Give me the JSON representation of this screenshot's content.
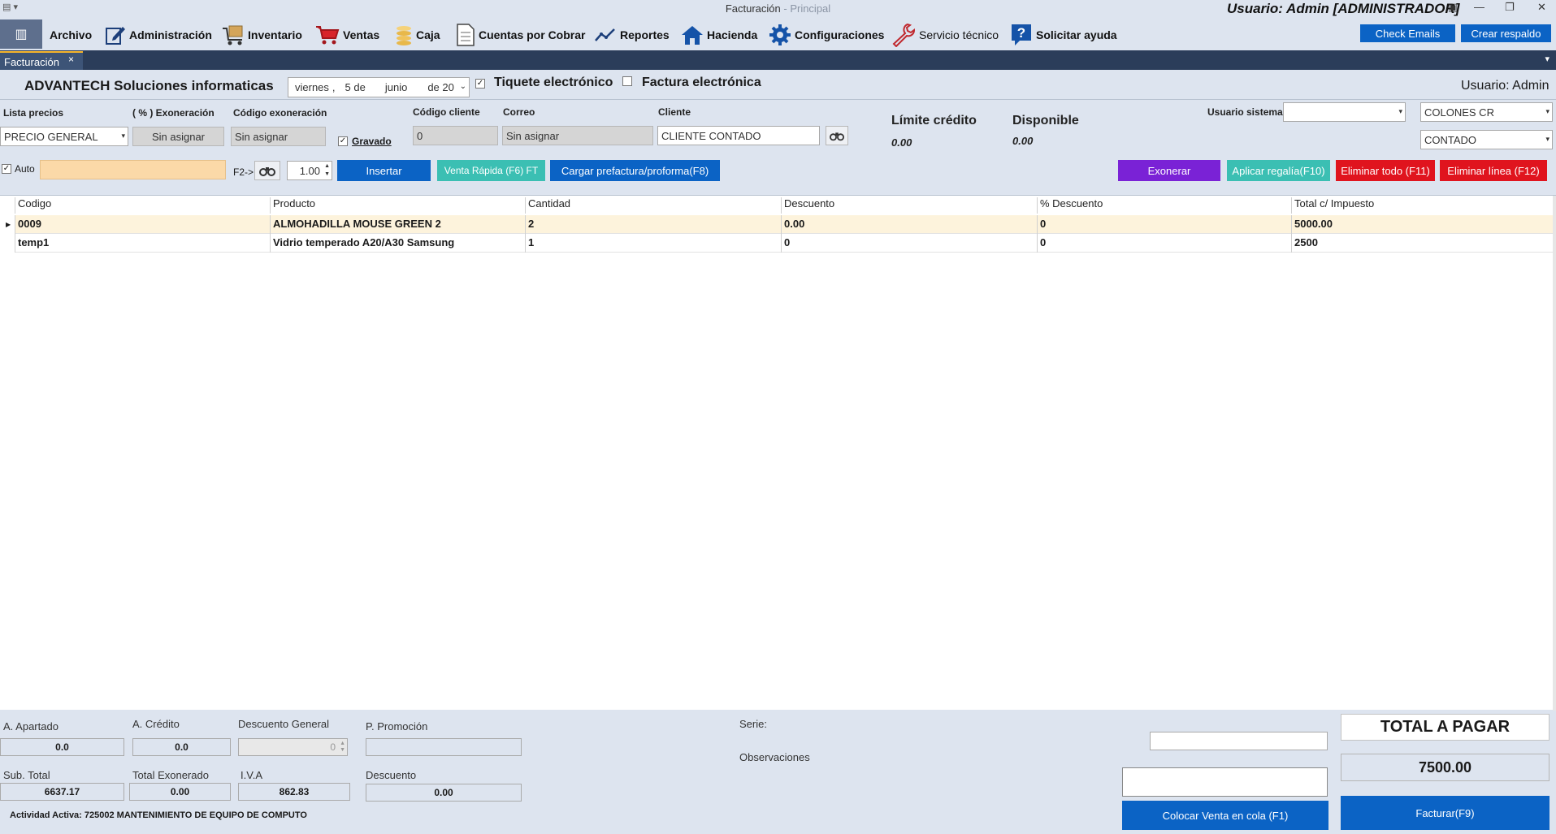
{
  "window": {
    "title": "Facturación",
    "subtitle": "- Principal",
    "user_label": "Usuario: Admin [ADMINISTRADOR]"
  },
  "menu": [
    {
      "label": "Archivo",
      "icon": "none"
    },
    {
      "label": "Administración",
      "icon": "edit-icon"
    },
    {
      "label": "Inventario",
      "icon": "cart-box-icon"
    },
    {
      "label": "Ventas",
      "icon": "shopping-cart-icon"
    },
    {
      "label": "Caja",
      "icon": "coins-icon"
    },
    {
      "label": "Cuentas por Cobrar",
      "icon": "document-icon"
    },
    {
      "label": "Reportes",
      "icon": "line-chart-icon"
    },
    {
      "label": "Hacienda",
      "icon": "home-icon"
    },
    {
      "label": "Configuraciones",
      "icon": "gear-icon"
    },
    {
      "label": "Servicio técnico",
      "icon": "wrench-icon"
    },
    {
      "label": "Solicitar ayuda",
      "icon": "help-icon"
    }
  ],
  "top_buttons": {
    "check_emails": "Check Emails",
    "backup": "Crear respaldo"
  },
  "tab": {
    "label": "Facturación",
    "close": "×"
  },
  "header": {
    "company": "ADVANTECH Soluciones informaticas",
    "date": {
      "weekday": "viernes",
      "sep": ",",
      "day": "5 de",
      "month": "junio",
      "year": "de 20"
    },
    "tiquete_label": "Tiquete electrónico",
    "tiquete_checked": true,
    "factura_label": "Factura electrónica",
    "factura_checked": false,
    "user": "Usuario: Admin"
  },
  "form": {
    "price_list_label": "Lista precios",
    "price_list_value": "PRECIO GENERAL",
    "exoneration_pct_label": "( % ) Exoneración",
    "exoneration_pct_value": "Sin asignar",
    "exoneration_code_label": "Código exoneración",
    "exoneration_code_value": "Sin asignar",
    "gravado_label": "Gravado",
    "gravado_checked": true,
    "client_code_label": "Código cliente",
    "client_code_value": "0",
    "email_label": "Correo",
    "email_value": "Sin asignar",
    "client_label": "Cliente",
    "client_value": "CLIENTE CONTADO",
    "credit_limit_label": "Límite crédito",
    "credit_limit_value": "0.00",
    "available_label": "Disponible",
    "available_value": "0.00",
    "system_user_label": "Usuario sistema",
    "system_user_value": "",
    "currency_value": "COLONES CR",
    "payment_value": "CONTADO",
    "auto_label": "Auto",
    "auto_checked": true,
    "product_search_value": "",
    "f2_label": "F2->",
    "quantity_value": "1.00"
  },
  "actions": {
    "insert": "Insertar",
    "quick_sale": "Venta Rápida (F6) FT",
    "load_proforma": "Cargar prefactura/proforma(F8)",
    "exonerate": "Exonerar",
    "gift": "Aplicar regalía(F10)",
    "delete_all": "Eliminar todo (F11)",
    "delete_line": "Eliminar línea (F12)"
  },
  "colors": {
    "blue": "#0b63c5",
    "teal": "#3bbfb3",
    "purple": "#7a22d6",
    "red": "#e0141e",
    "selected_row": "#fdf3dc"
  },
  "table": {
    "columns": [
      "Codigo",
      "Producto",
      "Cantidad",
      "Descuento",
      "% Descuento",
      "Total c/ Impuesto"
    ],
    "rows": [
      [
        "0009",
        "ALMOHADILLA MOUSE GREEN 2",
        "2",
        "0.00",
        "0",
        "5000.00"
      ],
      [
        "temp1",
        "Vidrio temperado A20/A30 Samsung",
        "1",
        "0",
        "0",
        "2500"
      ]
    ],
    "selected_row": 0
  },
  "footer": {
    "apartado_label": "A. Apartado",
    "apartado_value": "0.0",
    "credito_label": "A. Crédito",
    "credito_value": "0.0",
    "desc_general_label": "Descuento General",
    "desc_general_value": "0",
    "promo_label": "P. Promoción",
    "promo_value": "",
    "subtotal_label": "Sub. Total",
    "subtotal_value": "6637.17",
    "exonerated_label": "Total Exonerado",
    "exonerated_value": "0.00",
    "iva_label": "I.V.A",
    "iva_value": "862.83",
    "discount_label": "Descuento",
    "discount_value": "0.00",
    "serie_label": "Serie:",
    "observations_label": "Observaciones",
    "activity": "Actividad Activa: 725002 MANTENIMIENTO DE EQUIPO DE COMPUTO",
    "total_label": "TOTAL A PAGAR",
    "total_value": "7500.00",
    "queue_button": "Colocar Venta en cola (F1)",
    "invoice_button": "Facturar(F9)"
  }
}
